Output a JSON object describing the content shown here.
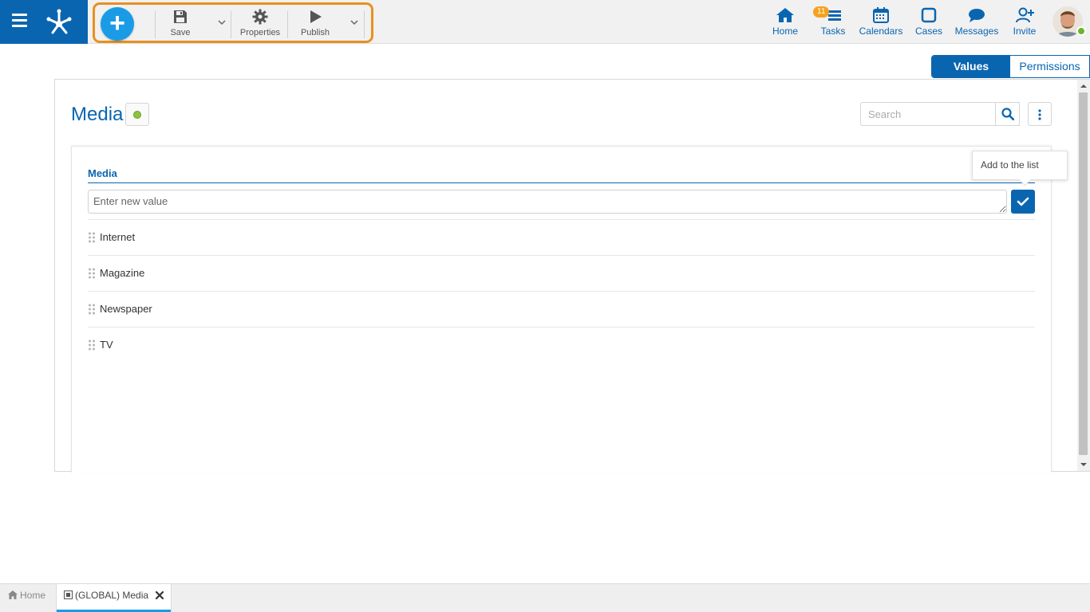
{
  "toolbar": {
    "add_icon": "plus-icon",
    "save_label": "Save",
    "properties_label": "Properties",
    "publish_label": "Publish"
  },
  "nav": {
    "home": "Home",
    "tasks": "Tasks",
    "tasks_badge": "11",
    "calendars": "Calendars",
    "cases": "Cases",
    "messages": "Messages",
    "invite": "Invite"
  },
  "tabs": {
    "values": "Values",
    "permissions": "Permissions",
    "active": "Values"
  },
  "page": {
    "title": "Media",
    "status_color": "#8cc43f",
    "search_placeholder": "Search"
  },
  "list_editor": {
    "label": "Media",
    "input_placeholder": "Enter new value",
    "tooltip": "Add to the list",
    "items": [
      "Internet",
      "Magazine",
      "Newspaper",
      "TV"
    ]
  },
  "bottom_tabs": {
    "home": "Home",
    "media": "(GLOBAL) Media"
  },
  "colors": {
    "brand": "#0a65b0",
    "accent": "#1a9be6",
    "highlight": "#e8901e",
    "badge": "#f4a21d"
  }
}
